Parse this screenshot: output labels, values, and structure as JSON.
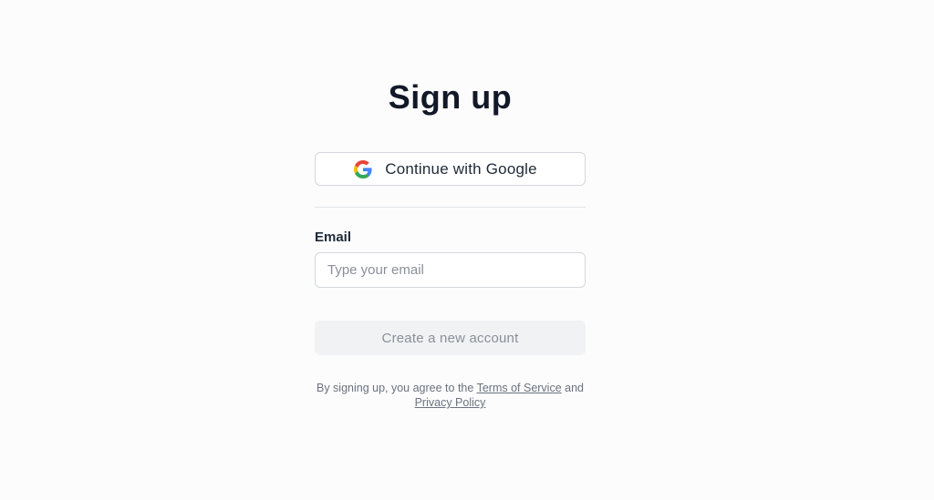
{
  "page": {
    "title": "Sign up"
  },
  "google_button": {
    "label": "Continue with Google",
    "icon": "google-icon"
  },
  "email": {
    "label": "Email",
    "placeholder": "Type your email",
    "value": ""
  },
  "submit": {
    "label": "Create a new account",
    "disabled": true
  },
  "legal": {
    "prefix": "By signing up, you agree to the",
    "terms_link": "Terms of Service",
    "conjunction": "and",
    "privacy_link": "Privacy Policy"
  },
  "colors": {
    "background": "#fcfcfc",
    "text_primary": "#111827",
    "text_muted": "#6b7280",
    "border": "#d4d7dc",
    "disabled_bg": "#f1f2f4",
    "google_blue": "#4285F4",
    "google_red": "#EA4335",
    "google_yellow": "#FBBC05",
    "google_green": "#34A853"
  }
}
